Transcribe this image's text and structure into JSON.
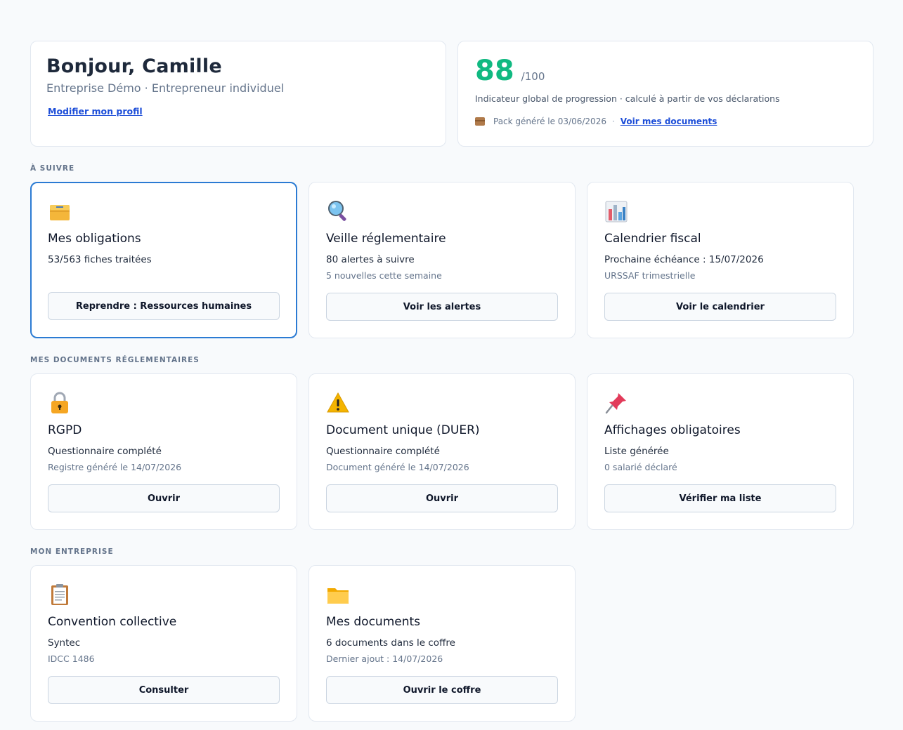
{
  "header": {
    "greeting": "Bonjour, Camille",
    "subtitle": "Entreprise Démo · Entrepreneur individuel",
    "profile_link": "Modifier mon profil"
  },
  "score": {
    "value": "88",
    "max": "/100",
    "description": "Indicateur global de progression · calculé à partir de vos déclarations",
    "pack_text": "Pack généré le 03/06/2026",
    "separator": "·",
    "docs_link": "Voir mes documents"
  },
  "sections": {
    "follow": "À SUIVRE",
    "documents": "MES DOCUMENTS RÉGLEMENTAIRES",
    "company": "MON ENTREPRISE"
  },
  "cards": {
    "obligations": {
      "icon": "card-file-box-icon",
      "title": "Mes obligations",
      "line1": "53/563 fiches traitées",
      "line2": "",
      "button": "Reprendre : Ressources humaines"
    },
    "veille": {
      "icon": "magnifying-glass-icon",
      "title": "Veille réglementaire",
      "line1": "80 alertes à suivre",
      "line2": "5 nouvelles cette semaine",
      "button": "Voir les alertes"
    },
    "calendrier": {
      "icon": "bar-chart-icon",
      "title": "Calendrier fiscal",
      "line1": "Prochaine échéance : 15/07/2026",
      "line2": "URSSAF trimestrielle",
      "button": "Voir le calendrier"
    },
    "rgpd": {
      "icon": "lock-icon",
      "title": "RGPD",
      "line1": "Questionnaire complété",
      "line2": "Registre généré le 14/07/2026",
      "button": "Ouvrir"
    },
    "duer": {
      "icon": "warning-icon",
      "title": "Document unique (DUER)",
      "line1": "Questionnaire complété",
      "line2": "Document généré le 14/07/2026",
      "button": "Ouvrir"
    },
    "affichages": {
      "icon": "pushpin-icon",
      "title": "Affichages obligatoires",
      "line1": "Liste générée",
      "line2": "0 salarié déclaré",
      "button": "Vérifier ma liste"
    },
    "convention": {
      "icon": "clipboard-icon",
      "title": "Convention collective",
      "line1": "Syntec",
      "line2": "IDCC 1486",
      "button": "Consulter"
    },
    "mesdocs": {
      "icon": "folder-icon",
      "title": "Mes documents",
      "line1": "6 documents dans le coffre",
      "line2": "Dernier ajout : 14/07/2026",
      "button": "Ouvrir le coffre"
    }
  },
  "colors": {
    "score": "#10b981",
    "link": "#1d4ed8",
    "active_border": "#2b7bd3"
  }
}
